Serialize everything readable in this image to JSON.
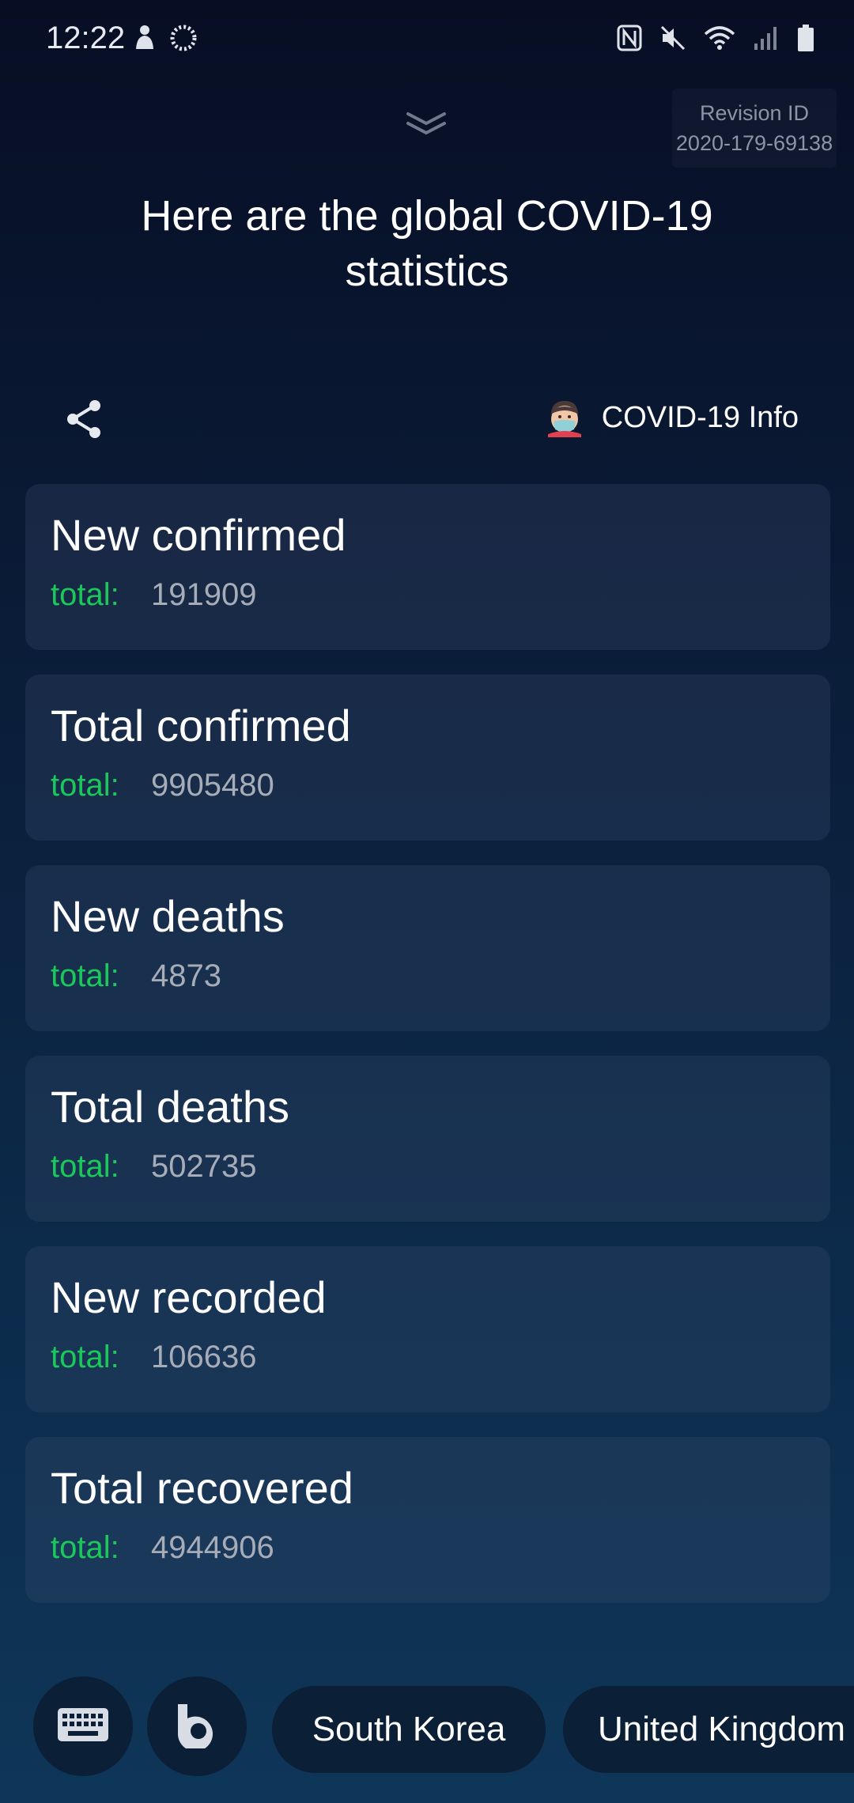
{
  "status_bar": {
    "time": "12:22",
    "left_icons": [
      "person-notification-icon",
      "loading-spinner-icon"
    ],
    "right_icons": [
      "nfc-icon",
      "mute-icon",
      "wifi-icon",
      "signal-icon",
      "battery-icon"
    ]
  },
  "revision": {
    "label": "Revision ID",
    "id": "2020-179-69138"
  },
  "header": {
    "title": "Here are the global COVID-19 statistics"
  },
  "actions": {
    "share_icon": "share-icon",
    "info_label": "COVID-19 Info",
    "info_icon": "masked-face-icon"
  },
  "stats": [
    {
      "title": "New confirmed",
      "label": "total:",
      "value": "191909"
    },
    {
      "title": "Total confirmed",
      "label": "total:",
      "value": "9905480"
    },
    {
      "title": "New deaths",
      "label": "total:",
      "value": "4873"
    },
    {
      "title": "Total deaths",
      "label": "total:",
      "value": "502735"
    },
    {
      "title": "New recorded",
      "label": "total:",
      "value": "106636"
    },
    {
      "title": "Total recovered",
      "label": "total:",
      "value": "4944906"
    }
  ],
  "bottom": {
    "keyboard_icon": "keyboard-icon",
    "bixby_icon": "bixby-icon",
    "suggestions": [
      "South Korea",
      "United Kingdom"
    ]
  },
  "colors": {
    "accent_green": "#1ac95a",
    "background_top": "#070e24",
    "background_bottom": "#0e3658"
  }
}
